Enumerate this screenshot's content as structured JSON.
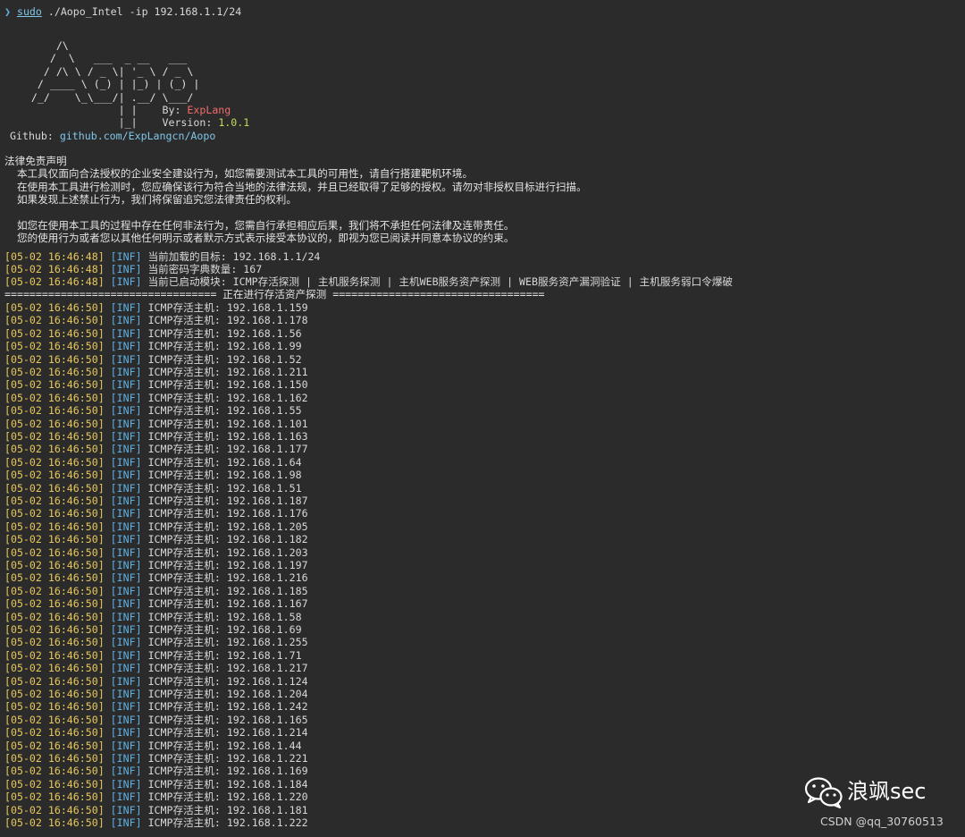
{
  "prompt": {
    "arrow": "❯",
    "sudo": "sudo",
    "command": " ./Aopo_Intel -ip 192.168.1.1/24"
  },
  "banner": {
    "ascii": "         /\\\n        /  \\   ___  _ __   ___\n       / /\\ \\ / _ \\| '_ \\ / _ \\\n      / ____ \\ (_) | |_) | (_) |\n     /_/    \\_\\___/| .__/ \\___/\n                   | |    ",
    "ascii_tail": "                   |_|    ",
    "by_label": "By: ",
    "author": "ExpLang",
    "version_label": "Version: ",
    "version": "1.0.1",
    "github_label": "Github: ",
    "github_url": "github.com/ExpLangcn/Aopo"
  },
  "disclaimer": {
    "title": "法律免责声明",
    "lines": [
      "  本工具仅面向合法授权的企业安全建设行为，如您需要测试本工具的可用性，请自行搭建靶机环境。",
      "  在使用本工具进行检测时，您应确保该行为符合当地的法律法规，并且已经取得了足够的授权。请勿对非授权目标进行扫描。",
      "  如果发现上述禁止行为，我们将保留追究您法律责任的权利。",
      "",
      "  如您在使用本工具的过程中存在任何非法行为，您需自行承担相应后果，我们将不承担任何法律及连带责任。",
      "  您的使用行为或者您以其他任何明示或者默示方式表示接受本协议的，即视为您已阅读并同意本协议的约束。"
    ]
  },
  "status_lines": [
    {
      "ts": "[05-02 16:46:48]",
      "lvl": "[INF]",
      "msg": "当前加载的目标: 192.168.1.1/24"
    },
    {
      "ts": "[05-02 16:46:48]",
      "lvl": "[INF]",
      "msg": "当前密码字典数量: 167"
    },
    {
      "ts": "[05-02 16:46:48]",
      "lvl": "[INF]",
      "msg": "当前已启动模块: ICMP存活探测 | 主机服务探测 | 主机WEB服务资产探测 | WEB服务资产漏洞验证 | 主机服务弱口令爆破"
    }
  ],
  "separator": "================================== 正在进行存活资产探测 ==================================",
  "alive_prefix": "ICMP存活主机: ",
  "alive_ts": "[05-02 16:46:50]",
  "alive_lvl": "[INF]",
  "alive_hosts": [
    "192.168.1.159",
    "192.168.1.178",
    "192.168.1.56",
    "192.168.1.99",
    "192.168.1.52",
    "192.168.1.211",
    "192.168.1.150",
    "192.168.1.162",
    "192.168.1.55",
    "192.168.1.101",
    "192.168.1.163",
    "192.168.1.177",
    "192.168.1.64",
    "192.168.1.98",
    "192.168.1.51",
    "192.168.1.187",
    "192.168.1.176",
    "192.168.1.205",
    "192.168.1.182",
    "192.168.1.203",
    "192.168.1.197",
    "192.168.1.216",
    "192.168.1.185",
    "192.168.1.167",
    "192.168.1.58",
    "192.168.1.69",
    "192.168.1.255",
    "192.168.1.71",
    "192.168.1.217",
    "192.168.1.124",
    "192.168.1.204",
    "192.168.1.242",
    "192.168.1.165",
    "192.168.1.214",
    "192.168.1.44",
    "192.168.1.221",
    "192.168.1.169",
    "192.168.1.184",
    "192.168.1.220",
    "192.168.1.181",
    "192.168.1.222"
  ],
  "watermark": {
    "title": "浪飒sec",
    "csdn": "CSDN @qq_30760513",
    "icon": "wechat-icon"
  }
}
